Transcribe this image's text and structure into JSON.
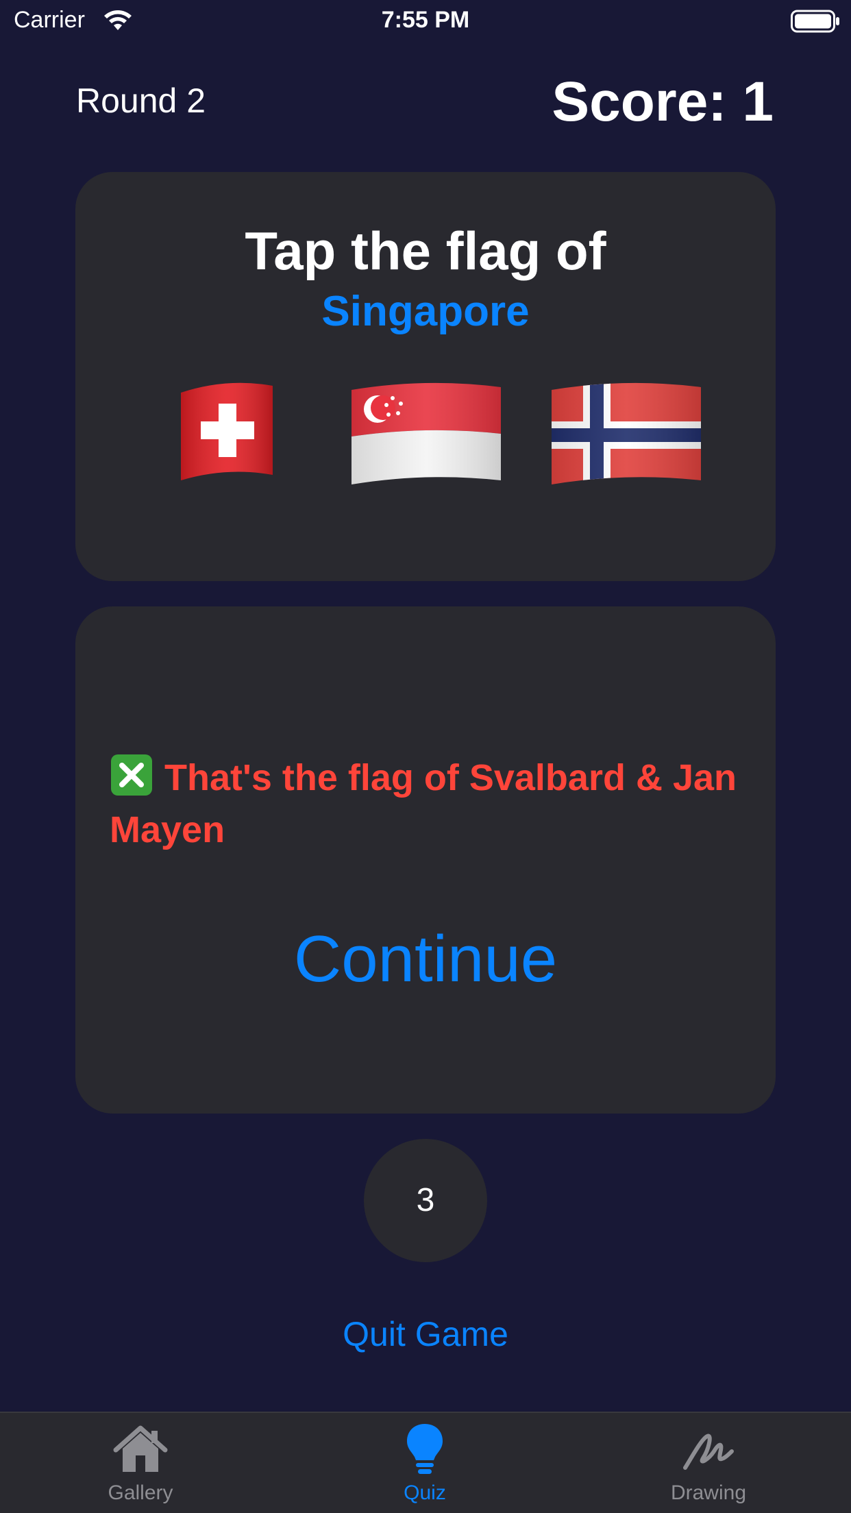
{
  "status_bar": {
    "carrier": "Carrier",
    "time": "7:55 PM"
  },
  "header": {
    "round": "Round 2",
    "score": "Score: 1"
  },
  "question": {
    "title": "Tap the flag of",
    "country": "Singapore",
    "flags": [
      {
        "country": "Switzerland",
        "icon": "switzerland-flag-icon"
      },
      {
        "country": "Singapore",
        "icon": "singapore-flag-icon"
      },
      {
        "country": "Norway",
        "icon": "norway-flag-icon"
      }
    ]
  },
  "answer": {
    "feedback": "That's the flag of Svalbard & Jan Mayen",
    "feedback_icon": "x-mark-icon",
    "continue_label": "Continue"
  },
  "countdown": "3",
  "quit_label": "Quit Game",
  "tab_bar": {
    "items": [
      {
        "label": "Gallery",
        "icon": "house-icon",
        "selected": false
      },
      {
        "label": "Quiz",
        "icon": "lightbulb-icon",
        "selected": true
      },
      {
        "label": "Drawing",
        "icon": "scribble-icon",
        "selected": false
      }
    ]
  },
  "colors": {
    "background": "#181836",
    "card": "#29292f",
    "accent": "#0a84ff",
    "error": "#ff453a",
    "inactive_tab": "#8e8e93"
  }
}
